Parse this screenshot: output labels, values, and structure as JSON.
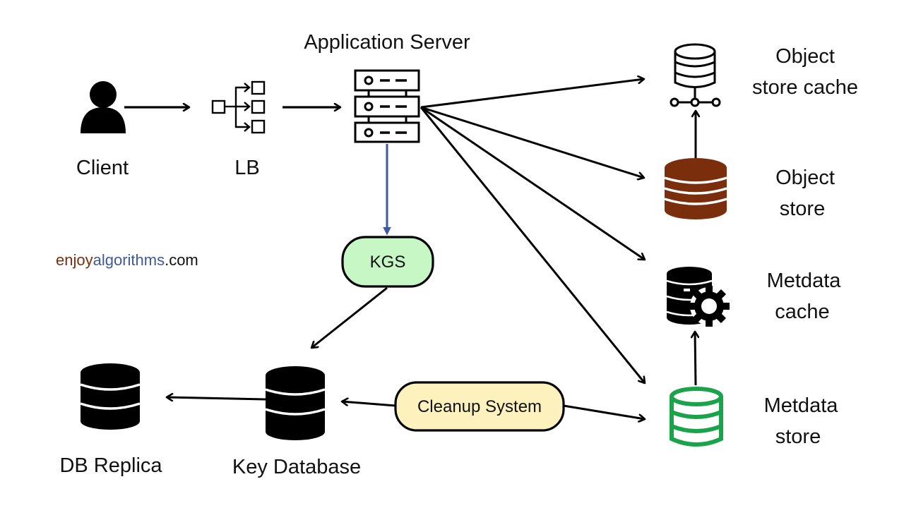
{
  "diagram": {
    "watermark": {
      "part1": "enjoy",
      "part2": "algorithms",
      "part3": ".com",
      "colors": {
        "part1": "#7a2e0c",
        "part2": "#3e5a9a",
        "part3": "#111111"
      }
    },
    "nodes": {
      "client": {
        "label": "Client",
        "icon": "user-icon"
      },
      "lb": {
        "label": "LB",
        "icon": "load-balancer-icon"
      },
      "app_server": {
        "label": "Application Server",
        "icon": "server-rack-icon"
      },
      "kgs": {
        "label": "KGS",
        "fill": "#c6f7c4"
      },
      "key_database": {
        "label": "Key Database",
        "icon": "database-icon"
      },
      "db_replica": {
        "label": "DB Replica",
        "icon": "database-icon"
      },
      "cleanup_system": {
        "label": "Cleanup System",
        "fill": "#fdf1bd"
      },
      "object_store_cache": {
        "label_line1": "Object",
        "label_line2": "store cache",
        "icon": "database-network-icon"
      },
      "object_store": {
        "label_line1": "Object",
        "label_line2": "store",
        "icon": "database-icon",
        "color": "#7a2e0c"
      },
      "metadata_cache": {
        "label_line1": "Metdata",
        "label_line2": "cache",
        "icon": "database-gear-icon"
      },
      "metadata_store": {
        "label_line1": "Metdata",
        "label_line2": "store",
        "icon": "database-outline-icon",
        "color": "#1aa34a"
      }
    },
    "edges": [
      {
        "from": "Client",
        "to": "LB"
      },
      {
        "from": "LB",
        "to": "Application Server"
      },
      {
        "from": "Application Server",
        "to": "Object store cache"
      },
      {
        "from": "Application Server",
        "to": "Object store"
      },
      {
        "from": "Application Server",
        "to": "Metdata cache"
      },
      {
        "from": "Application Server",
        "to": "Metdata store"
      },
      {
        "from": "Application Server",
        "to": "KGS",
        "color": "#3e5a9a"
      },
      {
        "from": "KGS",
        "to": "Key Database"
      },
      {
        "from": "Key Database",
        "to": "DB Replica"
      },
      {
        "from": "Cleanup System",
        "to": "Key Database"
      },
      {
        "from": "Cleanup System",
        "to": "Metdata store"
      },
      {
        "from": "Object store",
        "to": "Object store cache"
      },
      {
        "from": "Metdata store",
        "to": "Metdata cache"
      }
    ]
  }
}
